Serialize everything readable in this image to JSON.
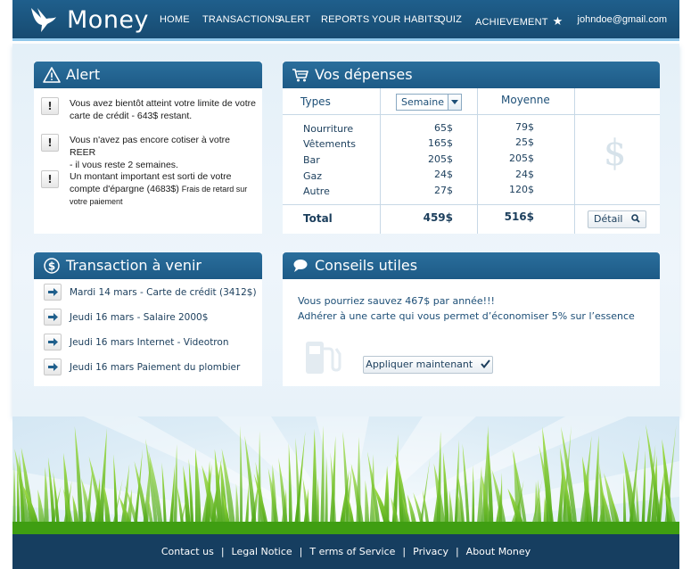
{
  "header": {
    "logo": "Money",
    "nav": [
      "HOME",
      "TRANSACTIONS",
      "ALERT",
      "REPORTS",
      "YOUR HABITS",
      "QUIZ",
      "ACHIEVEMENT"
    ],
    "user_email": "johndoe@gmail.com"
  },
  "alert": {
    "title": "Alert",
    "items": [
      {
        "line1": "Vous avez bientôt atteint votre limite de votre",
        "line2": "carte de crédit - 643$ restant."
      },
      {
        "line1": "Vous n'avez pas encore cotiser à votre REER",
        "line2": "- il vous reste 2 semaines."
      },
      {
        "line1": "Un montant important est sorti de votre",
        "line2": "compte d'épargne (4683$)",
        "line2_small": "Frais de retard sur",
        "line3_small": "votre paiement"
      }
    ]
  },
  "expenses": {
    "title": "Vos dépenses",
    "col_types": "Types",
    "period_select": "Semaine",
    "col_average": "Moyenne",
    "rows": [
      {
        "type": "Nourriture",
        "week": "65$",
        "avg": "79$"
      },
      {
        "type": "Vêtements",
        "week": "165$",
        "avg": "25$"
      },
      {
        "type": "Bar",
        "week": "205$",
        "avg": "205$"
      },
      {
        "type": "Gaz",
        "week": "24$",
        "avg": "24$"
      },
      {
        "type": "Autre",
        "week": "27$",
        "avg": "120$"
      }
    ],
    "total_label": "Total",
    "total_week": "459$",
    "total_avg": "516$",
    "detail_button": "Détail"
  },
  "transactions": {
    "title": "Transaction à venir",
    "items": [
      "Mardi 14 mars - Carte de crédit (3412$)",
      "Jeudi 16 mars - Salaire 2000$",
      "Jeudi 16 mars Internet - Videotron",
      "Jeudi 16 mars Paiement du plombier"
    ]
  },
  "tips": {
    "title": "Conseils utiles",
    "line1": "Vous pourriez sauvez 467$ par année!!!",
    "line2": "Adhérer à une carte qui vous permet d’économiser 5% sur l’essence",
    "apply_button": "Appliquer maintenant"
  },
  "footer": {
    "links": [
      "Contact us",
      "Legal Notice",
      "T erms of Service",
      "Privacy",
      "About Money"
    ]
  },
  "colors": {
    "header_bg": "#1d5a86",
    "footer_bg": "#163e60",
    "grass": "#6cc51f"
  }
}
